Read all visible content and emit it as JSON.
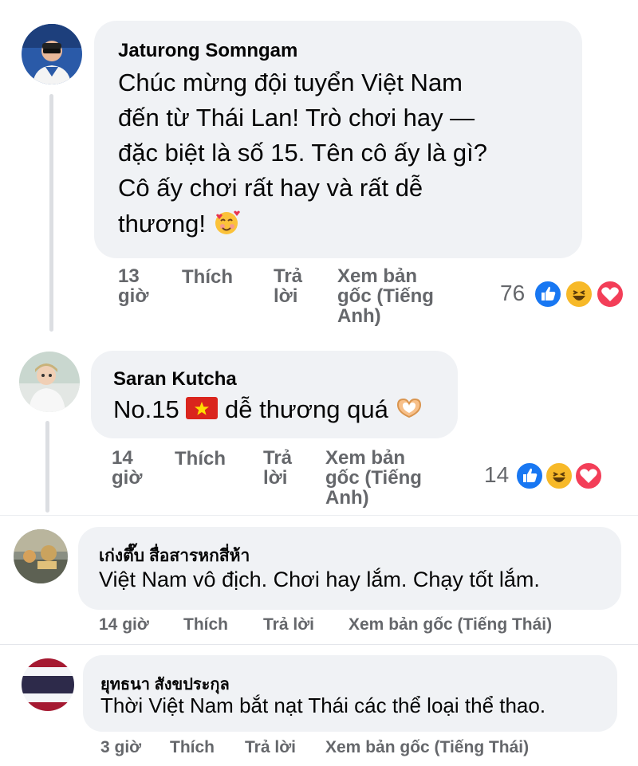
{
  "comments": [
    {
      "author": "Jaturong Somngam",
      "lines": [
        "Chúc mừng đội tuyển Việt Nam",
        "đến từ Thái Lan! Trò chơi hay —",
        "đặc biệt là số 15. Tên cô ấy là gì?",
        "Cô ấy chơi rất hay và rất dễ",
        "thương!"
      ],
      "emoji": "smiling-face-with-hearts",
      "time": [
        "13",
        "giờ"
      ],
      "like": "Thích",
      "reply": [
        "Trả",
        "lời"
      ],
      "translate": [
        "Xem bản",
        "gốc (Tiếng",
        "Anh)"
      ],
      "reaction_count": "76",
      "reactions": [
        "like-icon",
        "haha-icon",
        "love-icon"
      ]
    },
    {
      "author": "Saran Kutcha",
      "text": "No.15",
      "text_after_flag": "dễ thương quá",
      "flag": "vietnam-flag",
      "emoji": "heart-hands",
      "time": [
        "14",
        "giờ"
      ],
      "like": "Thích",
      "reply": [
        "Trả",
        "lời"
      ],
      "translate": [
        "Xem bản",
        "gốc (Tiếng",
        "Anh)"
      ],
      "reaction_count": "14",
      "reactions": [
        "like-icon",
        "haha-icon",
        "love-icon"
      ]
    },
    {
      "author": "เก่งตึ๊บ สื่อสารหกสี่ห้า",
      "text": "Việt Nam vô địch. Chơi hay lắm. Chạy tốt lắm.",
      "time": "14 giờ",
      "like": "Thích",
      "reply": "Trả lời",
      "translate": "Xem bản gốc (Tiếng Thái)"
    },
    {
      "author": "ยุทธนา สังขประกุล",
      "text": "Thời Việt Nam bắt nạt Thái các thể loại thể thao.",
      "time": "3 giờ",
      "like": "Thích",
      "reply": "Trả lời",
      "translate": "Xem bản gốc (Tiếng Thái)"
    }
  ],
  "colors": {
    "bubble": "#f0f2f5",
    "meta_text": "#65676b",
    "like_blue": "#1877f2",
    "haha_yellow": "#f7b928",
    "love_red": "#f33e58"
  }
}
